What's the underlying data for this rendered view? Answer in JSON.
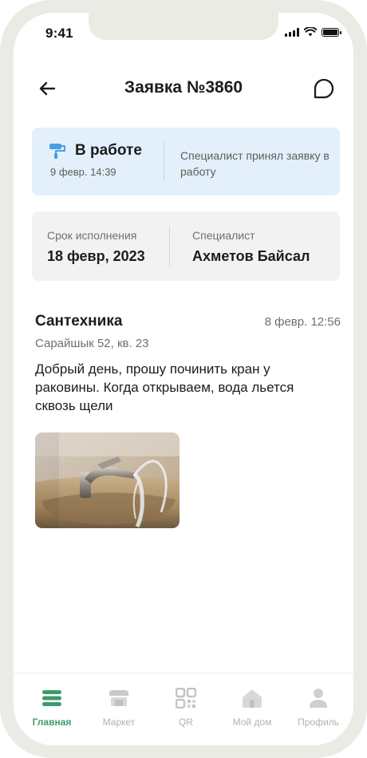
{
  "status_bar": {
    "time": "9:41"
  },
  "header": {
    "title": "Заявка №3860"
  },
  "status_card": {
    "status": "В работе",
    "date": "9 февр. 14:39",
    "description": "Специалист принял заявку в работу"
  },
  "info_card": {
    "deadline_label": "Срок исполнения",
    "deadline_value": "18 февр, 2023",
    "specialist_label": "Специалист",
    "specialist_value": "Ахметов Байсал"
  },
  "request": {
    "category": "Сантехника",
    "date": "8 февр. 12:56",
    "address": "Сарайшык 52, кв. 23",
    "text": "Добрый день, прошу починить кран у раковины. Когда открываем, вода льется сквозь щели"
  },
  "tabbar": {
    "items": [
      {
        "label": "Главная",
        "icon": "home-list-icon",
        "active": true
      },
      {
        "label": "Маркет",
        "icon": "market-icon",
        "active": false
      },
      {
        "label": "QR",
        "icon": "qr-icon",
        "active": false
      },
      {
        "label": "Мой дом",
        "icon": "house-icon",
        "active": false
      },
      {
        "label": "Профиль",
        "icon": "profile-icon",
        "active": false
      }
    ]
  },
  "colors": {
    "accent": "#3d9a6c",
    "status_card_bg": "#e3f0fb",
    "status_icon": "#4a9fe0",
    "info_card_bg": "#f2f2f2",
    "inactive_tab": "#b2b2b2"
  }
}
